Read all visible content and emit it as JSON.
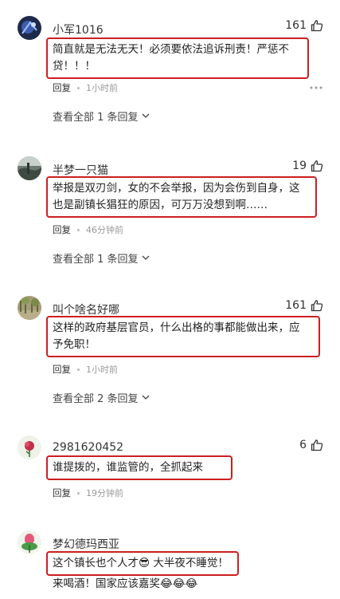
{
  "comments": [
    {
      "username": "小军1016",
      "likes": "161",
      "text": "简直就是无法无天！必须要依法追诉刑责！严惩不\n贷！！！",
      "reply_label": "回复",
      "time": "1小时前",
      "view_replies": "查看全部 1 条回复"
    },
    {
      "username": "半梦一只猫",
      "likes": "19",
      "text": "举报是双刃剑，女的不会举报，因为会伤到自身，这\n也是副镇长猖狂的原因，可万万没想到啊……",
      "reply_label": "回复",
      "time": "46分钟前",
      "view_replies": "查看全部 1 条回复"
    },
    {
      "username": "叫个啥名好哪",
      "likes": "161",
      "text": "这样的政府基层官员，什么出格的事都能做出来，应\n予免职！",
      "reply_label": "回复",
      "time": "1小时前",
      "view_replies": "查看全部 2 条回复"
    },
    {
      "username": "2981620452",
      "likes": "6",
      "text": "谁提拨的，谁监管的，全抓起来",
      "reply_label": "回复",
      "time": "19分钟前"
    },
    {
      "username": "梦幻德玛西亚",
      "text": "这个镇长也个人才😎 大半夜不睡觉！",
      "tail": "来喝酒！国家应该嘉奖😂😂😂"
    }
  ],
  "icons": {
    "like": "thumbs-up-icon",
    "more": "more-dots-icon",
    "expand": "chevron-down-icon"
  },
  "colors": {
    "highlight_border": "#cc1f1f"
  }
}
